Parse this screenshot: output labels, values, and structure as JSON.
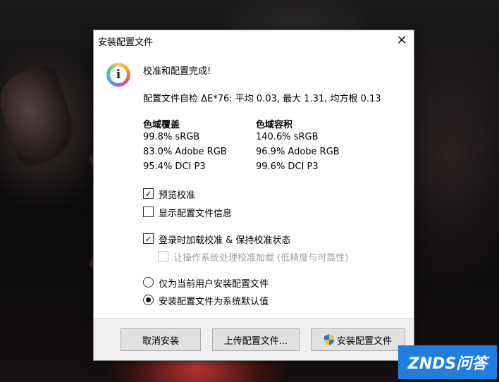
{
  "window": {
    "title": "安装配置文件",
    "close_glyph": "✕"
  },
  "message": {
    "heading": "校准和配置完成!",
    "self_check": "配置文件自检 ΔE*76: 平均 0.03, 最大 1.31, 均方根 0.13",
    "icon": "info-icon"
  },
  "gamut": {
    "coverage": {
      "title": "色域覆盖",
      "values": [
        "99.8% sRGB",
        "83.0% Adobe RGB",
        "95.4% DCI P3"
      ]
    },
    "volume": {
      "title": "色域容积",
      "values": [
        "140.6% sRGB",
        "96.9% Adobe RGB",
        "99.6% DCI P3"
      ]
    }
  },
  "options": {
    "preview_calibration": {
      "label": "预览校准",
      "checked": true
    },
    "show_profile_info": {
      "label": "显示配置文件信息",
      "checked": false
    },
    "load_on_login": {
      "label": "登录时加载校准 & 保持校准状态",
      "checked": true
    },
    "os_handles_loading": {
      "label": "让操作系统处理校准加载 (低精度与可靠性)",
      "checked": false,
      "disabled": true
    }
  },
  "install_scope": {
    "current_user": {
      "label": "仅为当前用户安装配置文件",
      "selected": false
    },
    "system_default": {
      "label": "安装配置文件为系统默认值",
      "selected": true
    }
  },
  "buttons": {
    "cancel": "取消安装",
    "upload": "上传配置文件...",
    "install": "安装配置文件",
    "install_icon": "uac-shield-icon"
  },
  "watermark": {
    "text": "ZNDS问答"
  },
  "colors": {
    "watermark_bg": "#1f7fe0",
    "dialog_bg": "#ffffff",
    "footer_bg": "#f0f0f0"
  }
}
